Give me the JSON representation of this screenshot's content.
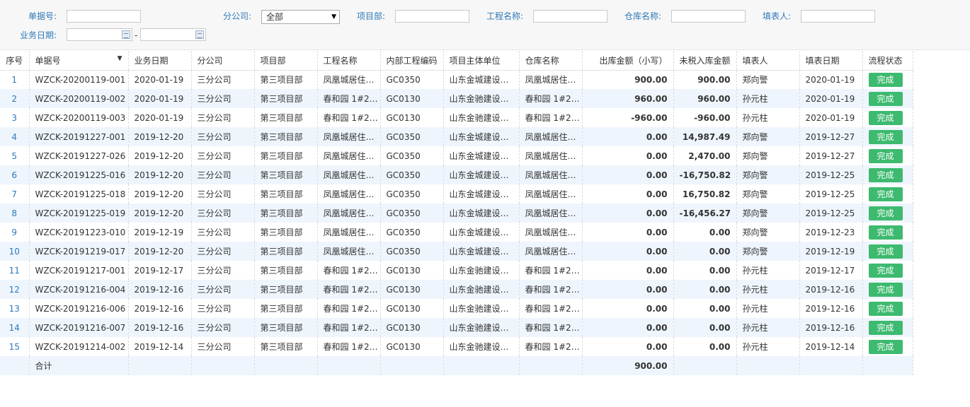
{
  "filters": {
    "doc_no_label": "单据号:",
    "branch_label": "分公司:",
    "branch_value": "全部",
    "project_dept_label": "项目部:",
    "project_name_label": "工程名称:",
    "warehouse_label": "仓库名称:",
    "filler_label": "填表人:",
    "biz_date_label": "业务日期:",
    "date_sep": "-"
  },
  "columns": [
    {
      "label": "序号"
    },
    {
      "label": "单据号"
    },
    {
      "label": "业务日期"
    },
    {
      "label": "分公司"
    },
    {
      "label": "项目部"
    },
    {
      "label": "工程名称"
    },
    {
      "label": "内部工程编码"
    },
    {
      "label": "项目主体单位"
    },
    {
      "label": "仓库名称"
    },
    {
      "label": "出库金额（小写）"
    },
    {
      "label": "未税入库金额"
    },
    {
      "label": "填表人"
    },
    {
      "label": "填表日期"
    },
    {
      "label": "流程状态"
    }
  ],
  "rows": [
    {
      "idx": "1",
      "no": "WZCK-20200119-001",
      "date": "2020-01-19",
      "branch": "三分公司",
      "dept": "第三项目部",
      "project": "凤凰城居住…",
      "code": "GC0350",
      "owner": "山东金城建设…",
      "warehouse": "凤凰城居住…",
      "out_amt": "900.00",
      "in_amt": "900.00",
      "filler": "郑向警",
      "fill_date": "2020-01-19",
      "status": "完成"
    },
    {
      "idx": "2",
      "no": "WZCK-20200119-002",
      "date": "2020-01-19",
      "branch": "三分公司",
      "dept": "第三项目部",
      "project": "春和园 1#2…",
      "code": "GC0130",
      "owner": "山东金驰建设…",
      "warehouse": "春和园 1#2…",
      "out_amt": "960.00",
      "in_amt": "960.00",
      "filler": "孙元柱",
      "fill_date": "2020-01-19",
      "status": "完成"
    },
    {
      "idx": "3",
      "no": "WZCK-20200119-003",
      "date": "2020-01-19",
      "branch": "三分公司",
      "dept": "第三项目部",
      "project": "春和园 1#2…",
      "code": "GC0130",
      "owner": "山东金驰建设…",
      "warehouse": "春和园 1#2…",
      "out_amt": "-960.00",
      "in_amt": "-960.00",
      "filler": "孙元柱",
      "fill_date": "2020-01-19",
      "status": "完成"
    },
    {
      "idx": "4",
      "no": "WZCK-20191227-001",
      "date": "2019-12-20",
      "branch": "三分公司",
      "dept": "第三项目部",
      "project": "凤凰城居住…",
      "code": "GC0350",
      "owner": "山东金城建设…",
      "warehouse": "凤凰城居住…",
      "out_amt": "0.00",
      "in_amt": "14,987.49",
      "filler": "郑向警",
      "fill_date": "2019-12-27",
      "status": "完成"
    },
    {
      "idx": "5",
      "no": "WZCK-20191227-026",
      "date": "2019-12-20",
      "branch": "三分公司",
      "dept": "第三项目部",
      "project": "凤凰城居住…",
      "code": "GC0350",
      "owner": "山东金城建设…",
      "warehouse": "凤凰城居住…",
      "out_amt": "0.00",
      "in_amt": "2,470.00",
      "filler": "郑向警",
      "fill_date": "2019-12-27",
      "status": "完成"
    },
    {
      "idx": "6",
      "no": "WZCK-20191225-016",
      "date": "2019-12-20",
      "branch": "三分公司",
      "dept": "第三项目部",
      "project": "凤凰城居住…",
      "code": "GC0350",
      "owner": "山东金城建设…",
      "warehouse": "凤凰城居住…",
      "out_amt": "0.00",
      "in_amt": "-16,750.82",
      "filler": "郑向警",
      "fill_date": "2019-12-25",
      "status": "完成"
    },
    {
      "idx": "7",
      "no": "WZCK-20191225-018",
      "date": "2019-12-20",
      "branch": "三分公司",
      "dept": "第三项目部",
      "project": "凤凰城居住…",
      "code": "GC0350",
      "owner": "山东金城建设…",
      "warehouse": "凤凰城居住…",
      "out_amt": "0.00",
      "in_amt": "16,750.82",
      "filler": "郑向警",
      "fill_date": "2019-12-25",
      "status": "完成"
    },
    {
      "idx": "8",
      "no": "WZCK-20191225-019",
      "date": "2019-12-20",
      "branch": "三分公司",
      "dept": "第三项目部",
      "project": "凤凰城居住…",
      "code": "GC0350",
      "owner": "山东金城建设…",
      "warehouse": "凤凰城居住…",
      "out_amt": "0.00",
      "in_amt": "-16,456.27",
      "filler": "郑向警",
      "fill_date": "2019-12-25",
      "status": "完成"
    },
    {
      "idx": "9",
      "no": "WZCK-20191223-010",
      "date": "2019-12-19",
      "branch": "三分公司",
      "dept": "第三项目部",
      "project": "凤凰城居住…",
      "code": "GC0350",
      "owner": "山东金城建设…",
      "warehouse": "凤凰城居住…",
      "out_amt": "0.00",
      "in_amt": "0.00",
      "filler": "郑向警",
      "fill_date": "2019-12-23",
      "status": "完成"
    },
    {
      "idx": "10",
      "no": "WZCK-20191219-017",
      "date": "2019-12-20",
      "branch": "三分公司",
      "dept": "第三项目部",
      "project": "凤凰城居住…",
      "code": "GC0350",
      "owner": "山东金城建设…",
      "warehouse": "凤凰城居住…",
      "out_amt": "0.00",
      "in_amt": "0.00",
      "filler": "郑向警",
      "fill_date": "2019-12-19",
      "status": "完成"
    },
    {
      "idx": "11",
      "no": "WZCK-20191217-001",
      "date": "2019-12-17",
      "branch": "三分公司",
      "dept": "第三项目部",
      "project": "春和园 1#2…",
      "code": "GC0130",
      "owner": "山东金驰建设…",
      "warehouse": "春和园 1#2…",
      "out_amt": "0.00",
      "in_amt": "0.00",
      "filler": "孙元柱",
      "fill_date": "2019-12-17",
      "status": "完成"
    },
    {
      "idx": "12",
      "no": "WZCK-20191216-004",
      "date": "2019-12-16",
      "branch": "三分公司",
      "dept": "第三项目部",
      "project": "春和园 1#2…",
      "code": "GC0130",
      "owner": "山东金驰建设…",
      "warehouse": "春和园 1#2…",
      "out_amt": "0.00",
      "in_amt": "0.00",
      "filler": "孙元柱",
      "fill_date": "2019-12-16",
      "status": "完成"
    },
    {
      "idx": "13",
      "no": "WZCK-20191216-006",
      "date": "2019-12-16",
      "branch": "三分公司",
      "dept": "第三项目部",
      "project": "春和园 1#2…",
      "code": "GC0130",
      "owner": "山东金驰建设…",
      "warehouse": "春和园 1#2…",
      "out_amt": "0.00",
      "in_amt": "0.00",
      "filler": "孙元柱",
      "fill_date": "2019-12-16",
      "status": "完成"
    },
    {
      "idx": "14",
      "no": "WZCK-20191216-007",
      "date": "2019-12-16",
      "branch": "三分公司",
      "dept": "第三项目部",
      "project": "春和园 1#2…",
      "code": "GC0130",
      "owner": "山东金驰建设…",
      "warehouse": "春和园 1#2…",
      "out_amt": "0.00",
      "in_amt": "0.00",
      "filler": "孙元柱",
      "fill_date": "2019-12-16",
      "status": "完成"
    },
    {
      "idx": "15",
      "no": "WZCK-20191214-002",
      "date": "2019-12-14",
      "branch": "三分公司",
      "dept": "第三项目部",
      "project": "春和园 1#2…",
      "code": "GC0130",
      "owner": "山东金驰建设…",
      "warehouse": "春和园 1#2…",
      "out_amt": "0.00",
      "in_amt": "0.00",
      "filler": "孙元柱",
      "fill_date": "2019-12-14",
      "status": "完成"
    }
  ],
  "summary": {
    "label": "合计",
    "out_amt": "900.00"
  },
  "icons": {
    "sort": "sort-caret-icon",
    "calendar": "calendar-icon",
    "dropdown": "dropdown-arrow-icon"
  },
  "colors": {
    "label_blue": "#2e79b9",
    "status_green": "#3dba6f",
    "row_alt": "#eef5fd"
  }
}
